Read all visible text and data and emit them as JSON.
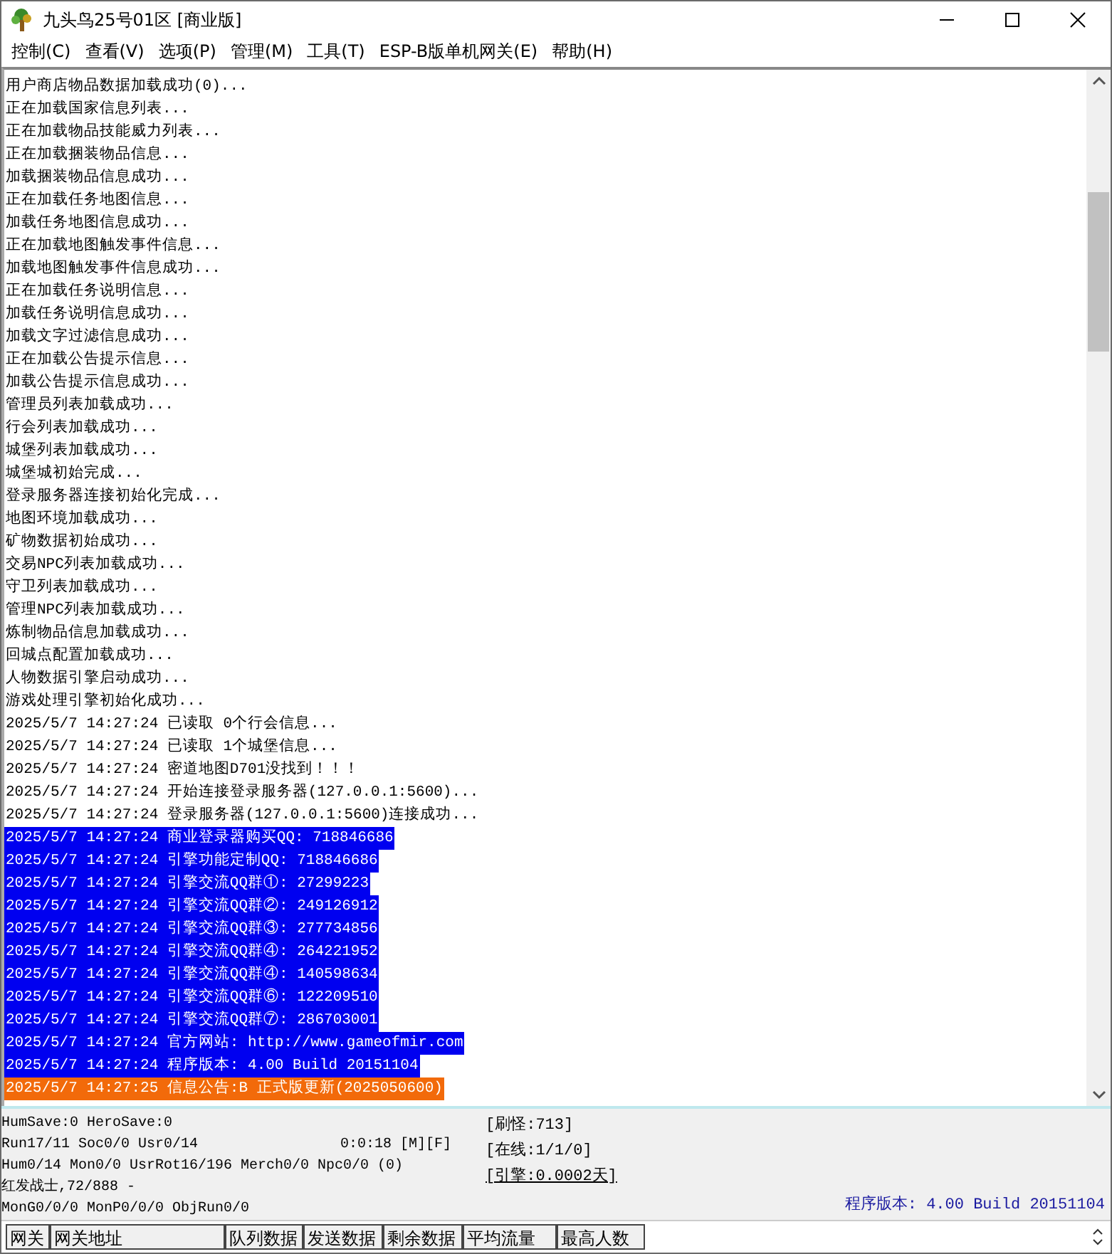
{
  "window": {
    "title": "九头鸟25号01区 [商业版]"
  },
  "menu": [
    "控制(C)",
    "查看(V)",
    "选项(P)",
    "管理(M)",
    "工具(T)",
    "ESP-B版单机网关(E)",
    "帮助(H)"
  ],
  "log": [
    {
      "text": "用户商店物品数据加载成功(0)...",
      "kind": "plain"
    },
    {
      "text": "正在加载国家信息列表...",
      "kind": "plain"
    },
    {
      "text": "正在加载物品技能威力列表...",
      "kind": "plain"
    },
    {
      "text": "正在加载捆装物品信息...",
      "kind": "plain"
    },
    {
      "text": "加载捆装物品信息成功...",
      "kind": "plain"
    },
    {
      "text": "正在加载任务地图信息...",
      "kind": "plain"
    },
    {
      "text": "加载任务地图信息成功...",
      "kind": "plain"
    },
    {
      "text": "正在加载地图触发事件信息...",
      "kind": "plain"
    },
    {
      "text": "加载地图触发事件信息成功...",
      "kind": "plain"
    },
    {
      "text": "正在加载任务说明信息...",
      "kind": "plain"
    },
    {
      "text": "加载任务说明信息成功...",
      "kind": "plain"
    },
    {
      "text": "加载文字过滤信息成功...",
      "kind": "plain"
    },
    {
      "text": "正在加载公告提示信息...",
      "kind": "plain"
    },
    {
      "text": "加载公告提示信息成功...",
      "kind": "plain"
    },
    {
      "text": "管理员列表加载成功...",
      "kind": "plain"
    },
    {
      "text": "行会列表加载成功...",
      "kind": "plain"
    },
    {
      "text": "城堡列表加载成功...",
      "kind": "plain"
    },
    {
      "text": "城堡城初始完成...",
      "kind": "plain"
    },
    {
      "text": "登录服务器连接初始化完成...",
      "kind": "plain"
    },
    {
      "text": "地图环境加载成功...",
      "kind": "plain"
    },
    {
      "text": "矿物数据初始成功...",
      "kind": "plain"
    },
    {
      "text": "交易NPC列表加载成功...",
      "kind": "plain"
    },
    {
      "text": "守卫列表加载成功...",
      "kind": "plain"
    },
    {
      "text": "管理NPC列表加载成功...",
      "kind": "plain"
    },
    {
      "text": "炼制物品信息加载成功...",
      "kind": "plain"
    },
    {
      "text": "回城点配置加载成功...",
      "kind": "plain"
    },
    {
      "text": "人物数据引擎启动成功...",
      "kind": "plain"
    },
    {
      "text": "游戏处理引擎初始化成功...",
      "kind": "plain"
    },
    {
      "text": "2025/5/7 14:27:24 已读取 0个行会信息...",
      "kind": "plain"
    },
    {
      "text": "2025/5/7 14:27:24 已读取 1个城堡信息...",
      "kind": "plain"
    },
    {
      "text": "2025/5/7 14:27:24 密道地图D701没找到！！！",
      "kind": "plain"
    },
    {
      "text": "2025/5/7 14:27:24 开始连接登录服务器(127.0.0.1:5600)...",
      "kind": "plain"
    },
    {
      "text": "2025/5/7 14:27:24 登录服务器(127.0.0.1:5600)连接成功...",
      "kind": "plain"
    },
    {
      "text": "2025/5/7 14:27:24 商业登录器购买QQ: 718846686",
      "kind": "selected"
    },
    {
      "text": "2025/5/7 14:27:24 引擎功能定制QQ: 718846686",
      "kind": "selected"
    },
    {
      "text": "2025/5/7 14:27:24 引擎交流QQ群①: 27299223",
      "kind": "selected"
    },
    {
      "text": "2025/5/7 14:27:24 引擎交流QQ群②: 249126912",
      "kind": "selected"
    },
    {
      "text": "2025/5/7 14:27:24 引擎交流QQ群③: 277734856",
      "kind": "selected"
    },
    {
      "text": "2025/5/7 14:27:24 引擎交流QQ群④: 264221952",
      "kind": "selected"
    },
    {
      "text": "2025/5/7 14:27:24 引擎交流QQ群④: 140598634",
      "kind": "selected"
    },
    {
      "text": "2025/5/7 14:27:24 引擎交流QQ群⑥: 122209510",
      "kind": "selected"
    },
    {
      "text": "2025/5/7 14:27:24 引擎交流QQ群⑦: 286703001",
      "kind": "selected"
    },
    {
      "text": "2025/5/7 14:27:24 官方网站: http://www.gameofmir.com",
      "kind": "selected"
    },
    {
      "text": "2025/5/7 14:27:24 程序版本: 4.00 Build 20151104",
      "kind": "selected"
    },
    {
      "text": "2025/5/7 14:27:25 信息公告:B 正式版更新(2025050600)",
      "kind": "notice"
    }
  ],
  "status": {
    "left": [
      "HumSave:0 HeroSave:0",
      "Run17/11 Soc0/0 Usr0/14",
      "Hum0/14 Mon0/0 UsrRot16/196 Merch0/0 Npc0/0 (0)",
      "红发战士,72/888 -",
      "MonG0/0/0 MonP0/0/0 ObjRun0/0"
    ],
    "timer": "0:0:18",
    "flags": "[M][F]",
    "counters": [
      {
        "text": "[刷怪:713]",
        "link": false
      },
      {
        "text": "[在线:1/1/0]",
        "link": false
      },
      {
        "text": "[引擎:0.0002天]",
        "link": true
      }
    ],
    "version": "程序版本: 4.00 Build 20151104"
  },
  "table": {
    "columns": [
      "网关",
      "网关地址",
      "队列数据",
      "发送数据",
      "剩余数据",
      "平均流量",
      "最高人数"
    ]
  }
}
